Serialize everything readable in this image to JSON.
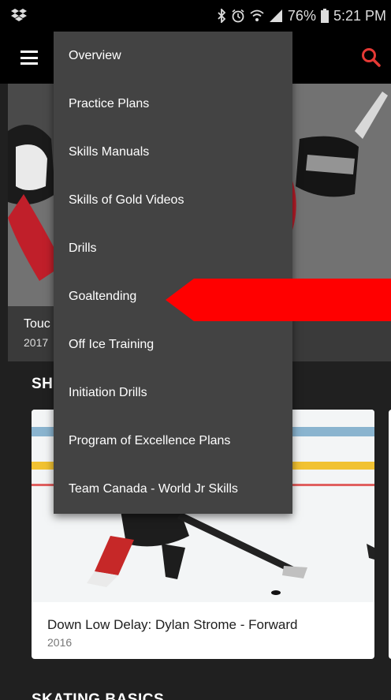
{
  "status_bar": {
    "left_icon": "dropbox-icon",
    "battery": "76%",
    "time": "5:21 PM",
    "icons": [
      "bluetooth-icon",
      "alarm-icon",
      "wifi-icon",
      "signal-icon",
      "battery-icon"
    ]
  },
  "app_bar": {
    "menu_icon": "hamburger-menu-icon",
    "search_icon": "search-icon",
    "accent_color": "#e53935"
  },
  "hero": {
    "title": "Touc",
    "year": "2017"
  },
  "sections": [
    {
      "title": "SH"
    },
    {
      "title": "SKATING BASICS"
    }
  ],
  "card": {
    "title": "Down Low Delay: Dylan Strome - Forward",
    "year": "2016"
  },
  "menu": {
    "items": [
      {
        "label": "Overview"
      },
      {
        "label": "Practice Plans"
      },
      {
        "label": "Skills Manuals"
      },
      {
        "label": "Skills of Gold Videos"
      },
      {
        "label": "Drills"
      },
      {
        "label": "Goaltending"
      },
      {
        "label": "Off Ice Training"
      },
      {
        "label": "Initiation Drills"
      },
      {
        "label": "Program of Excellence Plans"
      },
      {
        "label": "Team Canada - World Jr Skills"
      }
    ]
  },
  "annotation": {
    "arrow_color": "#ff0000",
    "points_to": "Goaltending"
  }
}
